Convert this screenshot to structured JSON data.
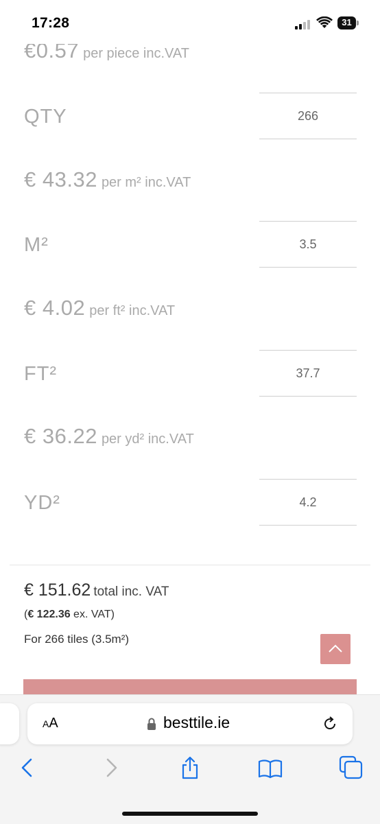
{
  "status_bar": {
    "time": "17:28",
    "battery": "31"
  },
  "pricing": {
    "per_piece": {
      "amount": "€0.57",
      "unit": "per piece inc.VAT"
    },
    "per_m2": {
      "amount": "€ 43.32",
      "unit": "per m² inc.VAT"
    },
    "per_ft2": {
      "amount": "€ 4.02",
      "unit": "per ft² inc.VAT"
    },
    "per_yd2": {
      "amount": "€ 36.22",
      "unit": "per yd² inc.VAT"
    }
  },
  "quantities": {
    "qty": {
      "label": "QTY",
      "value": "266"
    },
    "m2": {
      "label": "M²",
      "value": "3.5"
    },
    "ft2": {
      "label": "FT²",
      "value": "37.7"
    },
    "yd2": {
      "label": "YD²",
      "value": "4.2"
    }
  },
  "summary": {
    "total_amount": "€ 151.62",
    "total_label": "total inc. VAT",
    "ex_open": "(",
    "ex_amount": "€ 122.36",
    "ex_label": " ex. VAT)",
    "tiles_text": "For 266 tiles (3.5m²)"
  },
  "browser": {
    "aa_big": "A",
    "aa_small": "A",
    "url": "besttile.ie"
  },
  "colors": {
    "accent": "#d89393",
    "muted_text": "#aaaaaa",
    "ios_blue": "#1a73e8"
  }
}
